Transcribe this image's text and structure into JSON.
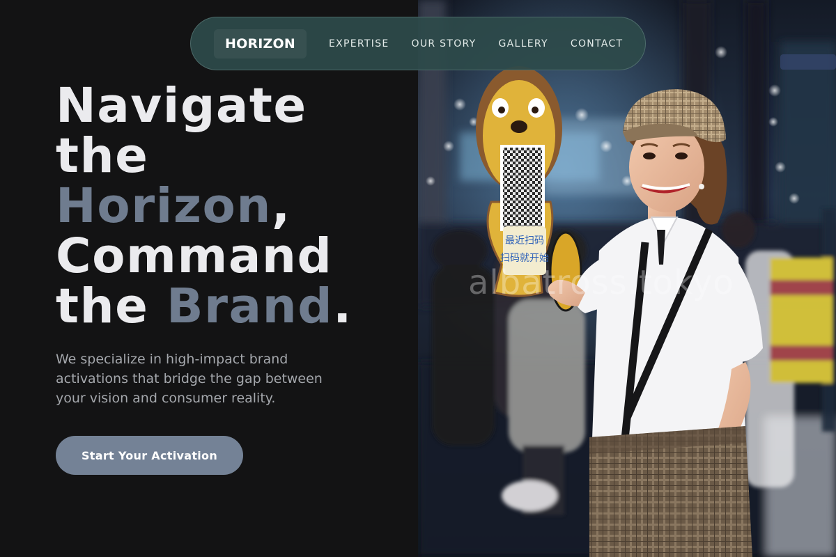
{
  "nav": {
    "brand": "HORIZON",
    "links": [
      "EXPERTISE",
      "OUR STORY",
      "GALLERY",
      "CONTACT"
    ]
  },
  "hero": {
    "title": {
      "line1": "Navigate",
      "line2": "the",
      "line3_accent": "Horizon",
      "line3_punct": ",",
      "line4": "Command",
      "line5_prefix": "the ",
      "line5_accent": "Brand",
      "line5_punct": "."
    },
    "subtitle": "We specialize in high-impact brand activations that bridge the gap between your vision and consumer reality.",
    "cta_label": "Start Your Activation"
  },
  "photo": {
    "watermark": "albatross.tokyo",
    "sign_text_1": "最近扫码",
    "sign_text_2": "扫码就开始"
  },
  "colors": {
    "background": "#131314",
    "nav_bg": "#2d4a4a",
    "accent": "#6f7c8f",
    "cta_bg": "#748296",
    "title": "#ebebee",
    "subtitle": "#a4a7ac"
  }
}
